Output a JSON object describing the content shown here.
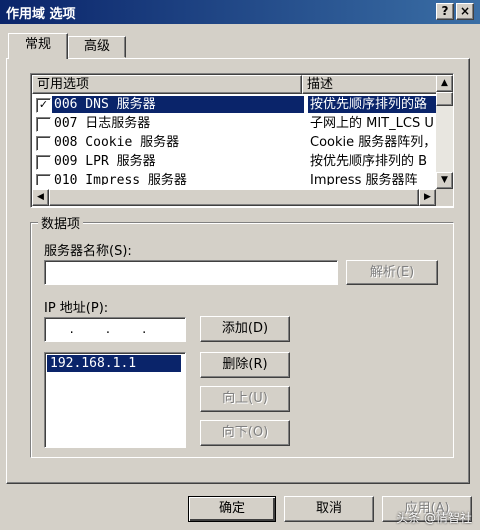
{
  "window": {
    "title": "作用域 选项",
    "help_button": "?",
    "close_button": "×"
  },
  "tabs": [
    {
      "label": "常规"
    },
    {
      "label": "高级"
    }
  ],
  "options_list": {
    "columns": [
      "可用选项",
      "描述"
    ],
    "rows": [
      {
        "checked": true,
        "name": "006 DNS 服务器",
        "desc": "按优先顺序排列的路"
      },
      {
        "checked": false,
        "name": "007 日志服务器",
        "desc": "子网上的 MIT_LCS U"
      },
      {
        "checked": false,
        "name": "008 Cookie 服务器",
        "desc": "Cookie 服务器阵列，"
      },
      {
        "checked": false,
        "name": "009 LPR 服务器",
        "desc": "按优先顺序排列的 B"
      },
      {
        "checked": false,
        "name": "010 Impress 服务器",
        "desc": "Impress 服务器阵"
      }
    ],
    "checkmark": "✓"
  },
  "data_group": {
    "legend": "数据项",
    "server_name_label": "服务器名称(S):",
    "server_name_value": "",
    "resolve_button": "解析(E)",
    "ip_label": "IP 地址(P):",
    "ip_input_value": ". . .",
    "add_button": "添加(D)",
    "ip_list": [
      "192.168.1.1"
    ],
    "remove_button": "删除(R)",
    "up_button": "向上(U)",
    "down_button": "向下(O)"
  },
  "footer": {
    "ok_button": "确定",
    "cancel_button": "取消",
    "apply_button": "应用(A)"
  },
  "watermark": "头条 @情智社"
}
